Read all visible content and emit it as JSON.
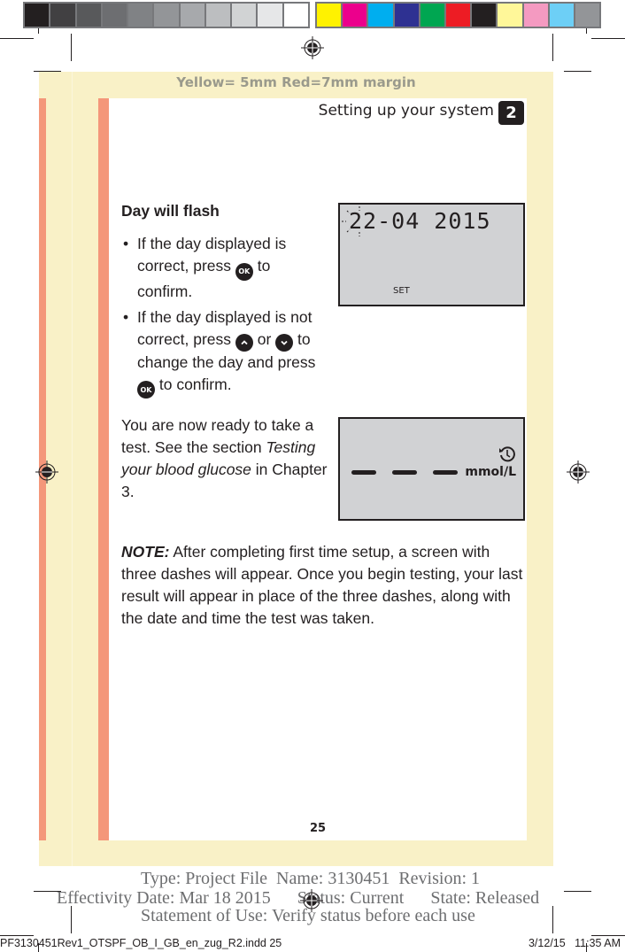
{
  "color_bar": {
    "grays": [
      "#231f20",
      "#414042",
      "#58595b",
      "#6d6e71",
      "#808285",
      "#939598",
      "#a7a9ac",
      "#bcbec0",
      "#d1d3d4",
      "#e6e7e8",
      "#ffffff"
    ],
    "colors": [
      "#fff200",
      "#ec008c",
      "#00aeef",
      "#2e3192",
      "#00a651",
      "#ed1c24",
      "#231f20",
      "#fff799",
      "#f49ac1",
      "#6dcff6",
      "#939598"
    ]
  },
  "margin_label": "Yellow= 5mm  Red=7mm margin",
  "header": {
    "title": "Setting up your system",
    "chapter_number": "2"
  },
  "section": {
    "heading": "Day will flash",
    "bullet_char": "•",
    "bullets": [
      {
        "before": "If the day displayed is correct, press ",
        "button1": "OK",
        "after": " to confirm."
      },
      {
        "before": "If the day displayed is not correct, press ",
        "button_up": "up-arrow",
        "middle": " or ",
        "button_down": "down-arrow",
        "after_mid": " to change the day and press ",
        "button_ok": "OK",
        "after": " to confirm."
      }
    ],
    "ready": {
      "line1": "You are now ready to take a test. See the section ",
      "italic": "Testing your blood glucose",
      "line2": " in Chapter 3."
    },
    "note": {
      "label": "NOTE:",
      "text": " After completing first time setup, a screen with three dashes will appear. Once you begin testing, your last result will appear in place of the three dashes, along with the date and time the test was taken."
    }
  },
  "lcd_date_screen": {
    "date_display": "22-04 2015",
    "flashing_field": "day",
    "mode_label": "SET"
  },
  "lcd_result_screen": {
    "dashes": 3,
    "unit": "mmol/L",
    "icon": "history-clock-icon"
  },
  "page_number": "25",
  "stamp": {
    "line1": "Type: Project File  Name: 3130451  Revision: 1",
    "line2": "Effectivity Date: Mar 18 2015      Status: Current      State: Released",
    "line3": "Statement of Use: Verify status before each use"
  },
  "slug": {
    "file": "PF3130451Rev1_OTSPF_OB_I_GB_en_zug_R2.indd   25",
    "date_time": "3/12/15   11:35 AM"
  }
}
